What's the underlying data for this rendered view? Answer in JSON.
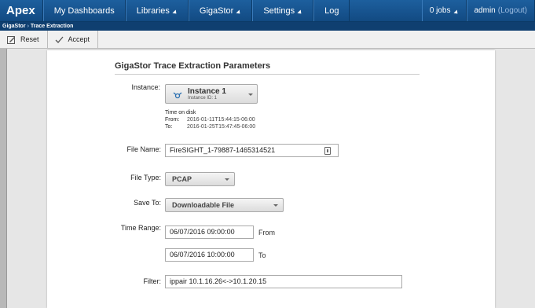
{
  "topnav": {
    "brand": "Apex",
    "items": [
      {
        "label": "My Dashboards",
        "has_caret": false
      },
      {
        "label": "Libraries",
        "has_caret": true
      },
      {
        "label": "GigaStor",
        "has_caret": true
      },
      {
        "label": "Settings",
        "has_caret": true
      },
      {
        "label": "Log",
        "has_caret": false
      }
    ],
    "jobs": "0 jobs",
    "user": "admin",
    "logout": "(Logout)"
  },
  "breadcrumb": {
    "parent": "GigaStor",
    "separator": "›",
    "current": "Trace Extraction"
  },
  "toolbar": {
    "reset_label": "Reset",
    "accept_label": "Accept"
  },
  "form": {
    "title": "GigaStor Trace Extraction Parameters",
    "instance": {
      "label": "Instance:",
      "name": "Instance 1",
      "id_text": "Instance ID: 1",
      "time_on_disk_label": "Time on disk",
      "from_label": "From:",
      "from_value": "2016-01-11T15:44:15-06:00",
      "to_label": "To:",
      "to_value": "2016-01-25T15:47:45-06:00"
    },
    "file_name": {
      "label": "File Name:",
      "value": "FireSIGHT_1-79887-1465314521"
    },
    "file_type": {
      "label": "File Type:",
      "value": "PCAP"
    },
    "save_to": {
      "label": "Save To:",
      "value": "Downloadable File"
    },
    "time_range": {
      "label": "Time Range:",
      "from_value": "06/07/2016 09:00:00",
      "from_label": "From",
      "to_value": "06/07/2016 10:00:00",
      "to_label": "To"
    },
    "filter": {
      "label": "Filter:",
      "value": "ippair 10.1.16.26<->10.1.20.15"
    }
  },
  "colors": {
    "nav": "#1a5a98",
    "breadcrumb": "#0f3f70",
    "background": "#b8b8b8"
  }
}
